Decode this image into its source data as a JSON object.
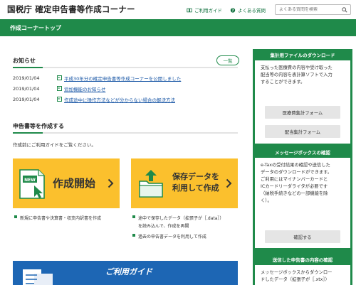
{
  "header": {
    "title": "国税庁 確定申告書等作成コーナー",
    "guide_link": "ご利用ガイド",
    "faq_link": "よくある質問",
    "search_placeholder": "よくある質問を検索"
  },
  "nav": {
    "page_title": "作成コーナートップ"
  },
  "notices": {
    "title": "お知らせ",
    "list_button": "一覧",
    "items": [
      {
        "date": "2019/01/04",
        "text": "平成30年分の確定申告書等作成コーナーを公開しました"
      },
      {
        "date": "2019/01/04",
        "text": "追加機能のお知らせ"
      },
      {
        "date": "2019/01/04",
        "text": "作成途中に操作方法などが分からない場合の解決方法"
      }
    ]
  },
  "create": {
    "title": "申告書等を作成する",
    "intro": "作成前にご利用ガイドをご覧ください。",
    "start_card": {
      "badge": "NEW",
      "label": "作成開始"
    },
    "resume_card": {
      "line1": "保存データを",
      "line2": "利用して作成"
    },
    "start_bullets": [
      "新規に申告書や決算書・収支内訳書を作成"
    ],
    "resume_bullets": [
      "途中で保存したデータ（拡張子が［.data］）",
      "を読み込んで、作成を再開",
      "過去の申告書データを利用して作成"
    ]
  },
  "guide_banner": {
    "label": "ご利用ガイド"
  },
  "sidebar": {
    "download": {
      "title": "集計用ファイルのダウンロード",
      "body": [
        "支払った医療費の内容や受け取った",
        "配当等の内容を表計算ソフトで入力",
        "することができます。"
      ],
      "btn1": "医療費集計フォーム",
      "btn2": "配当集計フォーム"
    },
    "messagebox": {
      "title": "メッセージボックスの確認",
      "body": [
        "e-Taxの受付結果の確認や送信した",
        "データのダウンロードができます。",
        "ご利用にはマイナンバーカードと",
        "ICカードリーダライタが必要です",
        "（納税手続きなどの一部機能を除",
        "く）。"
      ],
      "btn": "確認する"
    },
    "sent": {
      "title": "送信した申告書の内容の確認",
      "body": [
        "メッセージボックスからダウンロー",
        "ドしたデータ（拡張子が［.xtx］）"
      ]
    }
  },
  "colors": {
    "brand_green": "#1f8a4a",
    "card_yellow": "#fbc02d",
    "link_blue": "#1a57a6",
    "banner_blue": "#1d66b4"
  }
}
